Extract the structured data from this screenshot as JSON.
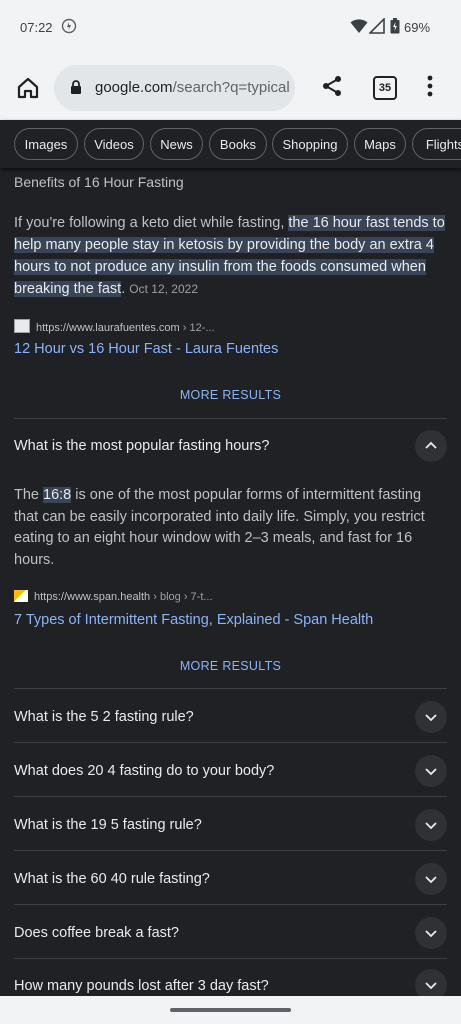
{
  "status": {
    "time": "07:22",
    "battery": "69%"
  },
  "toolbar": {
    "url_domain": "google.com",
    "url_path": "/search?q=typical",
    "tab_count": "35"
  },
  "chips": [
    "Images",
    "Videos",
    "News",
    "Books",
    "Shopping",
    "Maps",
    "Flights"
  ],
  "featured": {
    "title": "Benefits of 16 Hour Fasting",
    "text_before": "If you're following a keto diet while fasting, ",
    "text_highlight": "the 16 hour fast tends to help many people stay in ketosis by providing the body an extra 4 hours to not produce any insulin from the foods consumed when breaking the fast",
    "text_after": ".",
    "date": "Oct 12, 2022",
    "source_url": "https://www.laurafuentes.com",
    "source_path": " › 12-...",
    "link_title": "12 Hour vs 16 Hour Fast - Laura Fuentes",
    "more_label": "MORE RESULTS"
  },
  "questions": [
    {
      "q": "What is the most popular fasting hours?",
      "expanded": true,
      "answer_before": "The ",
      "answer_highlight": "16:8",
      "answer_after": " is one of the most popular forms of intermittent fasting that can be easily incorporated into daily life. Simply, you restrict eating to an eight hour window with 2–3 meals, and fast for 16 hours.",
      "source_url": "https://www.span.health",
      "source_path": " › blog › 7-t...",
      "link_title": "7 Types of Intermittent Fasting, Explained - Span Health",
      "more_label": "MORE RESULTS"
    },
    {
      "q": "What is the 5 2 fasting rule?"
    },
    {
      "q": "What does 20 4 fasting do to your body?"
    },
    {
      "q": "What is the 19 5 fasting rule?"
    },
    {
      "q": "What is the 60 40 rule fasting?"
    },
    {
      "q": "Does coffee break a fast?"
    },
    {
      "q": "How many pounds lost after 3 day fast?"
    }
  ]
}
